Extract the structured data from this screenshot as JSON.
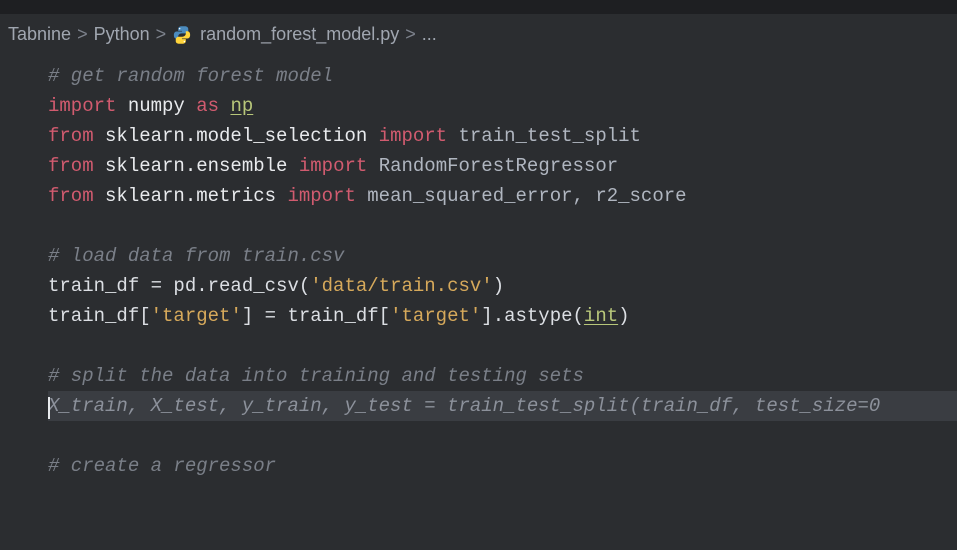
{
  "breadcrumb": {
    "items": [
      {
        "label": "Tabnine"
      },
      {
        "label": "Python"
      },
      {
        "label": "random_forest_model.py",
        "hasIcon": true
      },
      {
        "label": "..."
      }
    ],
    "separator": ">"
  },
  "code": {
    "l1_comment": "# get random forest model",
    "l2_import": "import",
    "l2_numpy": "numpy",
    "l2_as": "as",
    "l2_np": "np",
    "l3_from": "from",
    "l3_mod": "sklearn.model_selection",
    "l3_import": "import",
    "l3_name": "train_test_split",
    "l4_from": "from",
    "l4_mod": "sklearn.ensemble",
    "l4_import": "import",
    "l4_name": "RandomForestRegressor",
    "l5_from": "from",
    "l5_mod": "sklearn.metrics",
    "l5_import": "import",
    "l5_name": "mean_squared_error, r2_score",
    "l7_comment": "# load data from train.csv",
    "l8_a": "train_df = pd.read_csv(",
    "l8_str": "'data/train.csv'",
    "l8_b": ")",
    "l9_a": "train_df[",
    "l9_s1": "'target'",
    "l9_b": "] = train_df[",
    "l9_s2": "'target'",
    "l9_c": "].astype(",
    "l9_int": "int",
    "l9_d": ")",
    "l11_comment": "# split the data into training and testing sets",
    "l12_suggestion": "X_train, X_test, y_train, y_test = train_test_split(train_df, test_size=0",
    "l14_comment": "# create a regressor"
  }
}
